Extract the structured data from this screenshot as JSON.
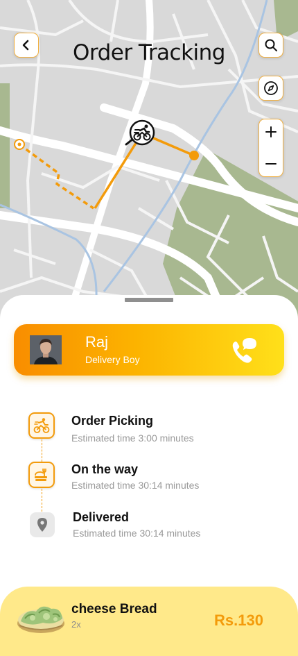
{
  "header": {
    "title": "Order Tracking"
  },
  "map": {
    "controls": [
      "back-icon",
      "search-icon",
      "compass-icon",
      "zoom-in-icon",
      "zoom-out-icon"
    ]
  },
  "driver": {
    "name": "Raj",
    "role": "Delivery Boy",
    "action_icon": "phone-chat-icon"
  },
  "status_steps": [
    {
      "title": "Order Picking",
      "subtitle": "Estimated time 3:00 minutes",
      "icon": "bicycle-icon",
      "state": "completed"
    },
    {
      "title": "On the way",
      "subtitle": "Estimated time 30:14 minutes",
      "icon": "food-icon",
      "state": "completed"
    },
    {
      "title": "Delivered",
      "subtitle": "Estimated time 30:14 minutes",
      "icon": "location-pin-icon",
      "state": "pending"
    }
  ],
  "order": {
    "item": "cheese Bread",
    "quantity": "2x",
    "price": "Rs.130"
  },
  "colors": {
    "accent": "#f39b0b",
    "map_block": "#d9d9d9",
    "map_park": "#a8b890",
    "order_bg": "#ffe98a"
  }
}
